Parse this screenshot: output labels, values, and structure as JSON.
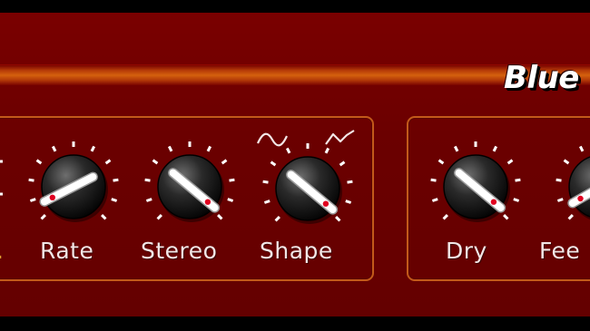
{
  "plugin": {
    "title": "Blue",
    "colors": {
      "panel": "#6b0000",
      "stripe": "#d4610e",
      "group_border": "#c25a1a",
      "label": "#f2e6e6",
      "knob_indicator": "#e00020"
    }
  },
  "modulation_group": {
    "knobs": [
      {
        "id": "rate",
        "label": "Rate"
      },
      {
        "id": "stereo",
        "label": "Stereo"
      },
      {
        "id": "shape",
        "label": "Shape",
        "wave_icons": [
          "sine-wave-icon",
          "triangle-wave-icon"
        ]
      }
    ]
  },
  "mix_group": {
    "knobs": [
      {
        "id": "dry",
        "label": "Dry"
      },
      {
        "id": "feedback",
        "label": "Fee"
      }
    ]
  }
}
